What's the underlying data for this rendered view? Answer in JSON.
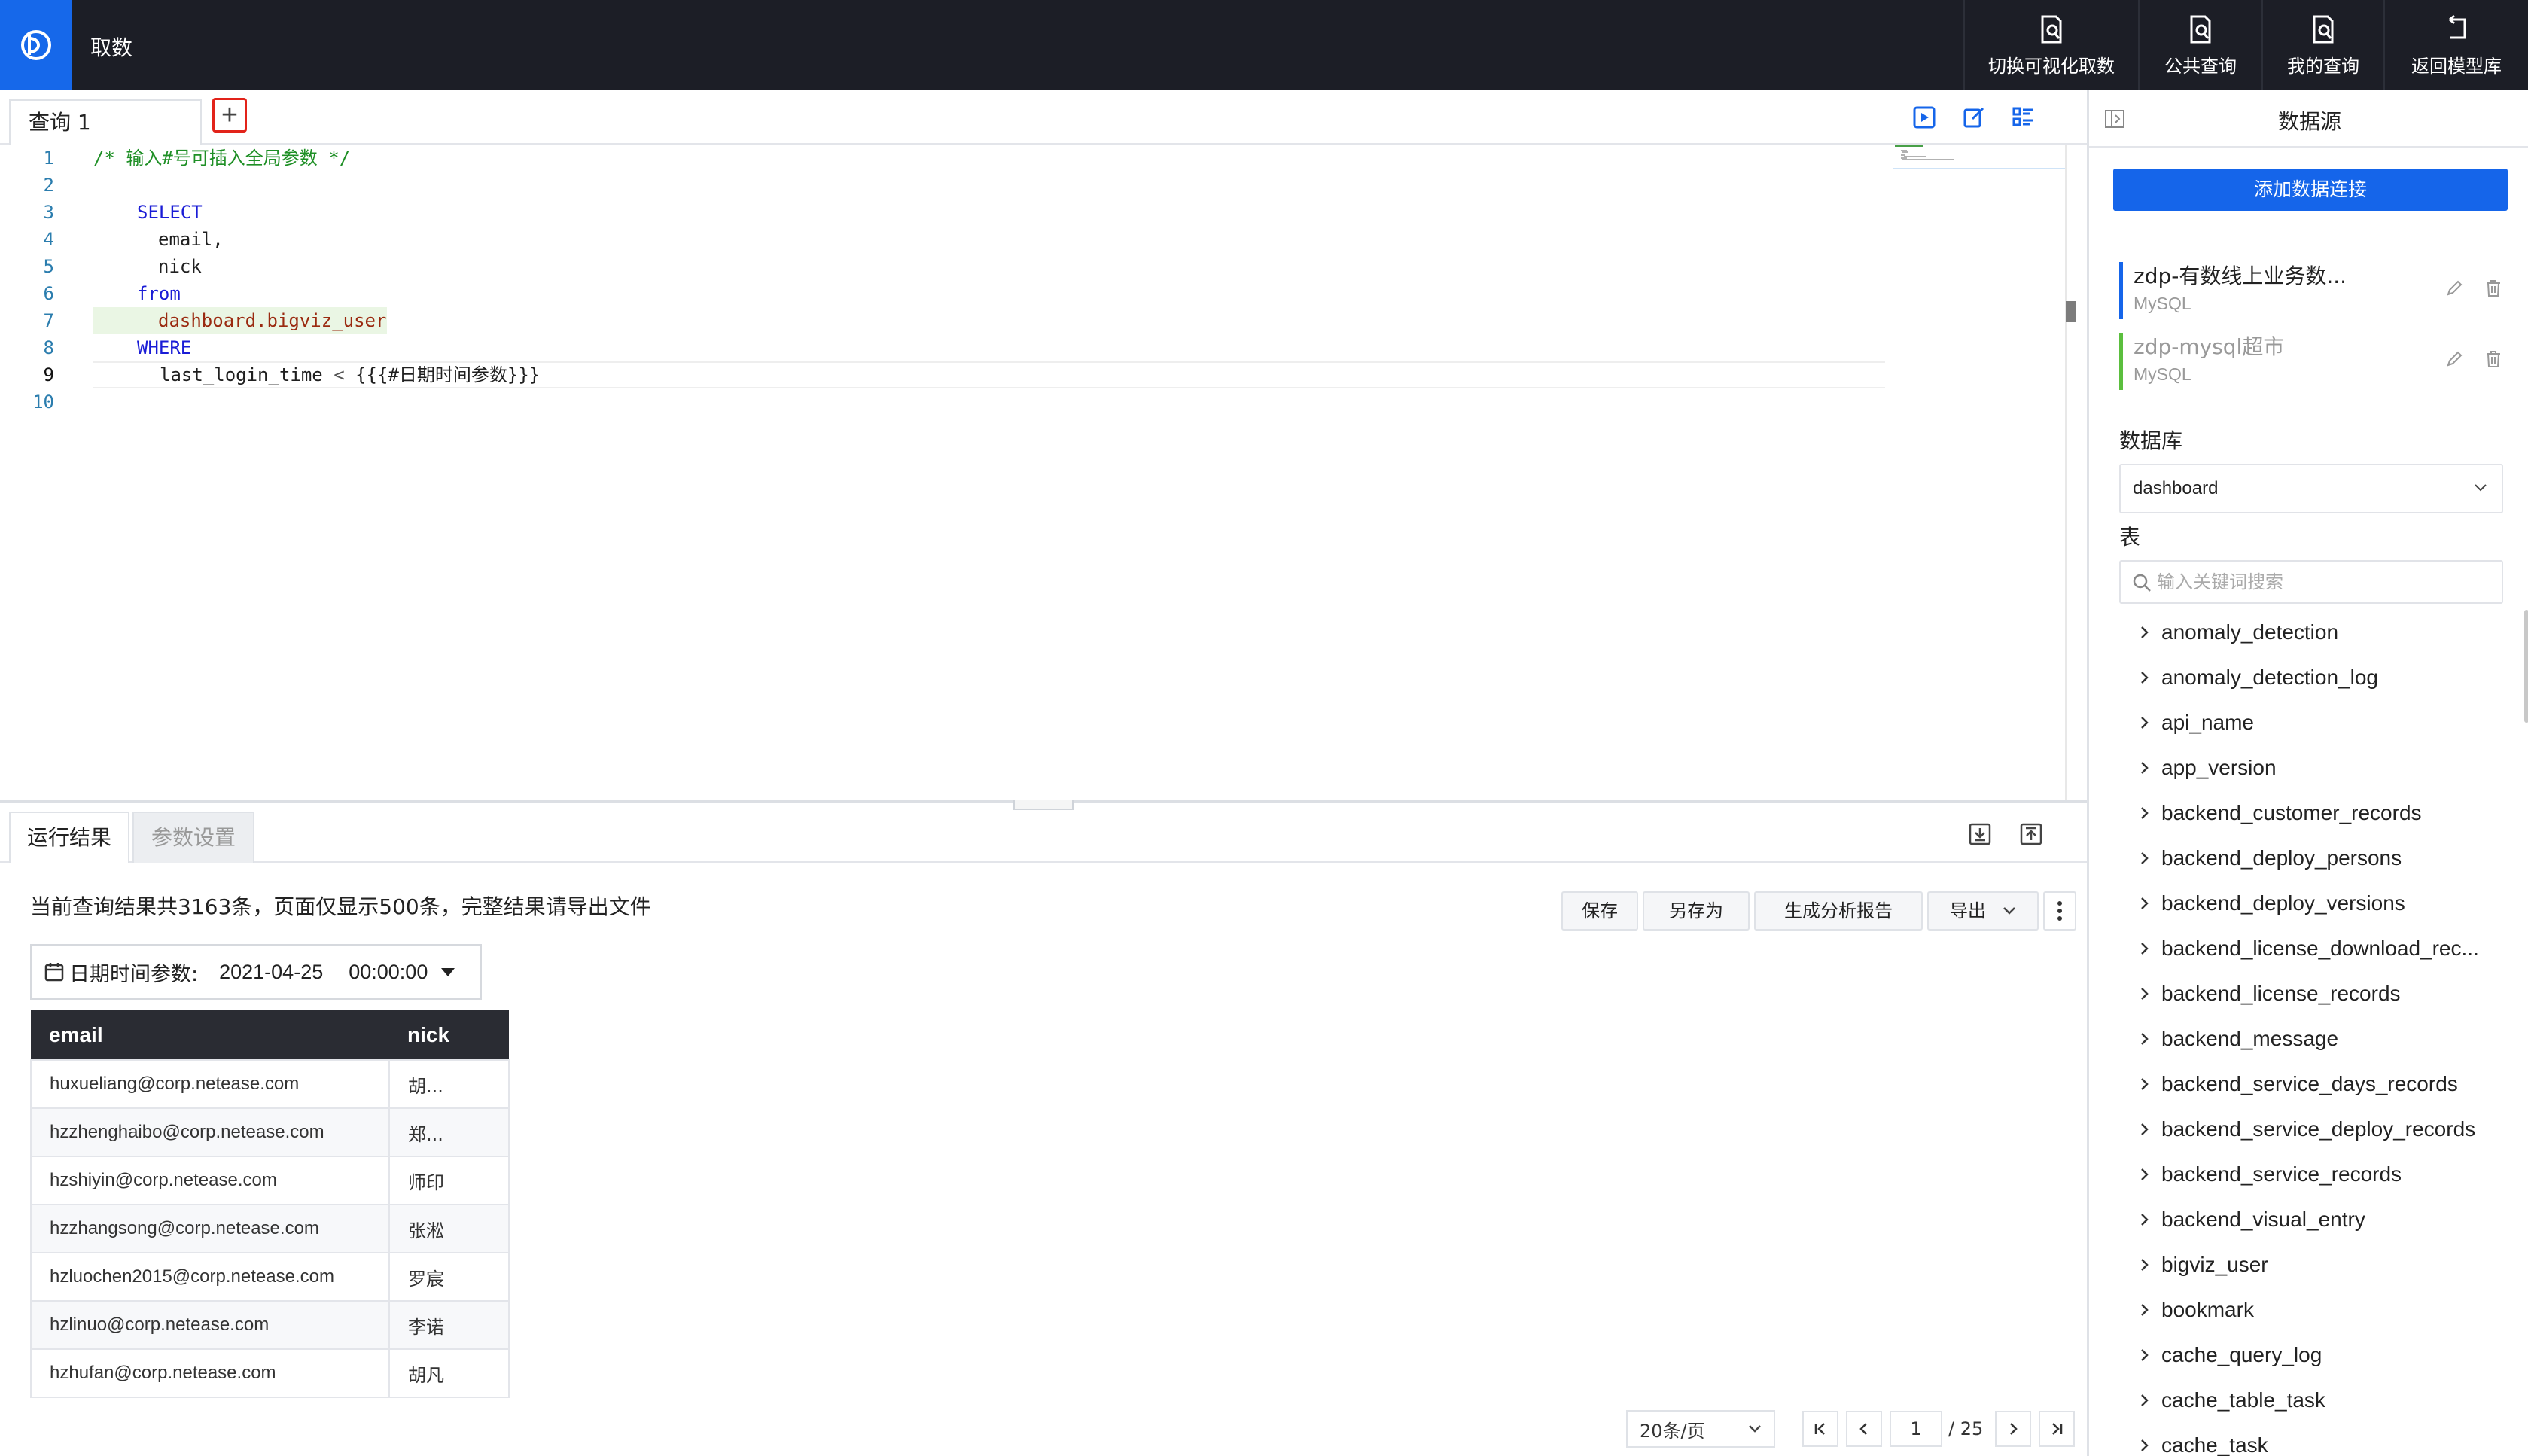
{
  "header": {
    "app_title": "取数",
    "actions": [
      {
        "label": "切换可视化取数",
        "icon": "document-search-icon"
      },
      {
        "label": "公共查询",
        "icon": "document-search-icon"
      },
      {
        "label": "我的查询",
        "icon": "document-search-icon"
      },
      {
        "label": "返回模型库",
        "icon": "return-icon"
      }
    ]
  },
  "editor": {
    "tab_label": "查询 1",
    "lines": [
      {
        "no": "1",
        "text": "/* 输入#号可插入全局参数 */"
      },
      {
        "no": "2",
        "text": ""
      },
      {
        "no": "3",
        "text": "SELECT"
      },
      {
        "no": "4",
        "text": "email,"
      },
      {
        "no": "5",
        "text": "nick"
      },
      {
        "no": "6",
        "text": "from"
      },
      {
        "no": "7",
        "text": "dashboard.bigviz_user"
      },
      {
        "no": "8",
        "text": "WHERE"
      },
      {
        "no": "9",
        "text_a": "last_login_time",
        "text_b": "<",
        "text_c": "{{{#日期时间参数}}}"
      },
      {
        "no": "10",
        "text": ""
      }
    ]
  },
  "results": {
    "tab_active": "运行结果",
    "tab_inactive": "参数设置",
    "notice": "当前查询结果共3163条，页面仅显示500条，完整结果请导出文件",
    "buttons": {
      "save": "保存",
      "save_as": "另存为",
      "report": "生成分析报告",
      "export": "导出"
    },
    "param": {
      "label": "日期时间参数:",
      "date": "2021-04-25",
      "time": "00:00:00"
    },
    "table": {
      "headers": [
        "email",
        "nick"
      ],
      "rows": [
        [
          "huxueliang@corp.netease.com",
          "胡..."
        ],
        [
          "hzzhenghaibo@corp.netease.com",
          "郑..."
        ],
        [
          "hzshiyin@corp.netease.com",
          "师印"
        ],
        [
          "hzzhangsong@corp.netease.com",
          "张淞"
        ],
        [
          "hzluochen2015@corp.netease.com",
          "罗宸"
        ],
        [
          "hzlinuo@corp.netease.com",
          "李诺"
        ],
        [
          "hzhufan@corp.netease.com",
          "胡凡"
        ]
      ]
    },
    "pagination": {
      "page_size": "20条/页",
      "current": "1",
      "total": "/ 25"
    }
  },
  "datasource": {
    "title": "数据源",
    "add_button": "添加数据连接",
    "connections": [
      {
        "name": "zdp-有数线上业务数...",
        "type": "MySQL"
      },
      {
        "name": "zdp-mysql超市",
        "type": "MySQL"
      }
    ],
    "db_label": "数据库",
    "db_value": "dashboard",
    "table_label": "表",
    "search_placeholder": "输入关键词搜索",
    "tables": [
      "anomaly_detection",
      "anomaly_detection_log",
      "api_name",
      "app_version",
      "backend_customer_records",
      "backend_deploy_persons",
      "backend_deploy_versions",
      "backend_license_download_rec...",
      "backend_license_records",
      "backend_message",
      "backend_service_days_records",
      "backend_service_deploy_records",
      "backend_service_records",
      "backend_visual_entry",
      "bigviz_user",
      "bookmark",
      "cache_query_log",
      "cache_table_task",
      "cache_task"
    ]
  },
  "colors": {
    "header_bg": "#1c1e26",
    "brand": "#1668ea",
    "table_header": "#2a2c33"
  }
}
